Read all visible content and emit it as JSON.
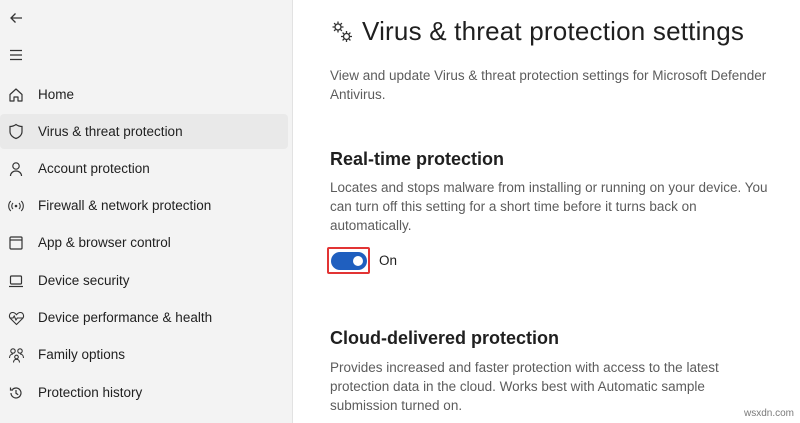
{
  "sidebar": {
    "back_icon": "back-arrow-icon",
    "menu_icon": "hamburger-menu-icon",
    "items": [
      {
        "label": "Home",
        "icon": "home-icon"
      },
      {
        "label": "Virus & threat protection",
        "icon": "shield-icon",
        "selected": true
      },
      {
        "label": "Account protection",
        "icon": "person-icon"
      },
      {
        "label": "Firewall & network protection",
        "icon": "wireless-icon"
      },
      {
        "label": "App & browser control",
        "icon": "app-window-icon"
      },
      {
        "label": "Device security",
        "icon": "laptop-icon"
      },
      {
        "label": "Device performance & health",
        "icon": "heart-pulse-icon"
      },
      {
        "label": "Family options",
        "icon": "family-icon"
      },
      {
        "label": "Protection history",
        "icon": "history-icon"
      }
    ]
  },
  "main": {
    "title": "Virus & threat protection settings",
    "title_icon": "gears-icon",
    "subtitle": "View and update Virus & threat protection settings for Microsoft Defender Antivirus.",
    "realtime": {
      "heading": "Real-time protection",
      "description": "Locates and stops malware from installing or running on your device. You can turn off this setting for a short time before it turns back on automatically.",
      "toggle_state": "On",
      "toggle_on": true
    },
    "cloud": {
      "heading": "Cloud-delivered protection",
      "description": "Provides increased and faster protection with access to the latest protection data in the cloud. Works best with Automatic sample submission turned on."
    }
  },
  "watermark": "wsxdn.com",
  "colors": {
    "accent": "#1f5fbf",
    "highlight_border": "#e23434",
    "sidebar_bg": "#f3f3f3"
  }
}
